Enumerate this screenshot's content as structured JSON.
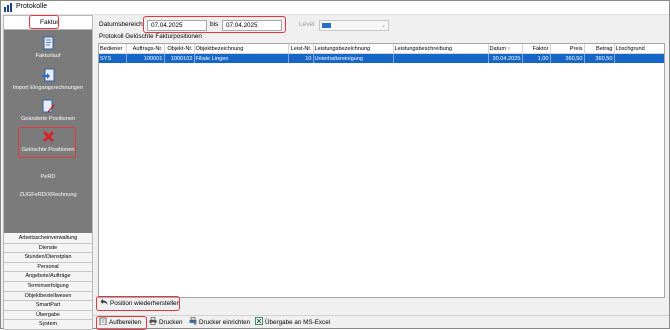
{
  "window": {
    "title": "Protokolle"
  },
  "nav": {
    "active_tab": "Faktur",
    "items": [
      {
        "label": "Fakturlauf",
        "icon": "document-icon"
      },
      {
        "label": "Import Eingangsrechnungen",
        "icon": "import-document-icon"
      },
      {
        "label": "Geänderte Positionen",
        "icon": "edit-document-icon"
      },
      {
        "label": "Gelöschte Positionen",
        "icon": "delete-x-icon"
      }
    ],
    "text_items": [
      "PeRD",
      "ZUGFeRD/XRechnung"
    ],
    "modules": [
      "Arbeitsscheinverwaltung",
      "Dienste",
      "Stunden/Dienstplan",
      "Personal",
      "Angebote/Aufträge",
      "Terminverfolgung",
      "Objektbestellwesen",
      "SmartPart",
      "Übergabe",
      "System"
    ]
  },
  "filter": {
    "label": "Datumsbereich",
    "from": "07.04.2025",
    "to_label": "bis",
    "to": "07.04.2025",
    "level_label": "Level",
    "level_color": "#2a70c5"
  },
  "table": {
    "caption": "Protokoll Gelöschte Fakturpositionen",
    "columns": [
      "Bediener",
      "Auftrags-Nr.",
      "Objekt-Nr.",
      "Objektbezeichnung",
      "Leist-Nr.",
      "Leistungsbezeichnung",
      "Leistungsbeschreibung",
      "Datum",
      "Faktor",
      "Preis",
      "Betrag",
      "Löschgrund"
    ],
    "rows": [
      [
        "SYS",
        "100001",
        "1000102",
        "Filiale Lingen",
        "10",
        "Unterhaltsreinigung",
        "",
        "30.04.2025",
        "1,00",
        "360,50",
        "360,50",
        ""
      ]
    ]
  },
  "buttons": {
    "restore": "Position wiederherstellen",
    "prepare": "Aufbereiten",
    "print": "Drucken",
    "printer_setup": "Drucker einrichten",
    "excel": "Übergabe an MS-Excel"
  },
  "colors": {
    "selection": "#1666c8",
    "highlight": "#e2373f",
    "nav_bg": "#7b7b7b"
  }
}
